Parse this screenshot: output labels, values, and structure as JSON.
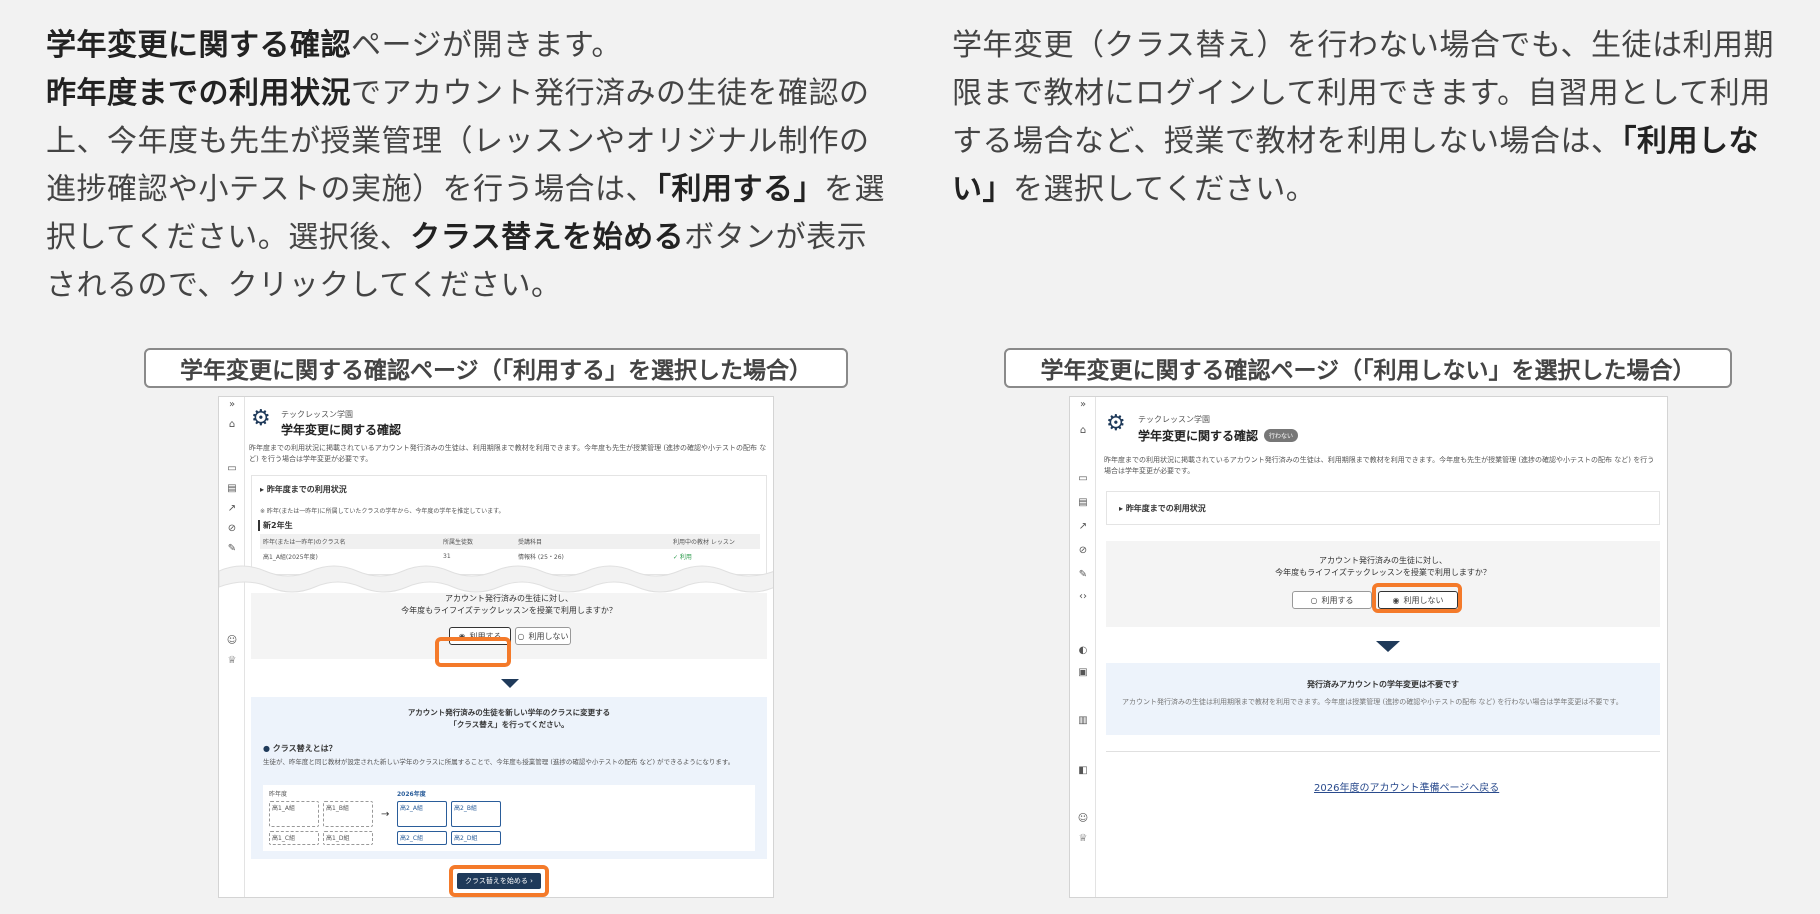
{
  "left_text": {
    "s1_bold": "学年変更に関する確認",
    "s1": "ページが開きます。",
    "s2_bold": "昨年度までの利用状況",
    "s2": "でアカウント発行済みの生徒を確認の上、今年度も先生が授業管理（レッスンやオリジナル制作の進捗確認や小テストの実施）を行う場合は、",
    "s3_bold": "「利用する」",
    "s3": "を選択してください。選択後、",
    "s4_bold": "クラス替えを始める",
    "s4": "ボタンが表示されるので、クリックしてください。"
  },
  "right_text": {
    "s1": "学年変更（クラス替え）を行わない場合でも、生徒は利用期限まで教材にログインして利用できます。自習用として利用する場合など、授業で教材を利用しない場合は、",
    "s2_bold": "「利用しない」",
    "s2": "を選択してください。"
  },
  "captions": {
    "left": "学年変更に関する確認ページ（「利用する」を選択した場合）",
    "right": "学年変更に関する確認ページ（「利用しない」を選択した場合）"
  },
  "screen": {
    "school": "テックレッスン学園",
    "title": "学年変更に関する確認",
    "status_badge": "行わない",
    "description": "昨年度までの利用状況に掲載されているアカウント発行済みの生徒は、利用期限まで教材を利用できます。今年度も先生が授業管理 (進捗の確認や小テストの配布 など) を行う場合は学年変更が必要です。",
    "usage_heading": "昨年度までの利用状況",
    "usage_note": "※ 昨年(または一昨年)に所属していたクラスの学年から、今年度の学年を推定しています。",
    "grade": "新2年生",
    "table_headers": [
      "昨年(または一昨年)のクラス名",
      "所属生徒数",
      "受講科目",
      "利用中の教材 レッスン"
    ],
    "table_row": [
      "高1_A組(2025年度)",
      "31",
      "情報科 (25・26)",
      "✓ 利用"
    ],
    "question_line1": "アカウント発行済みの生徒に対し、",
    "question_line2": "今年度もライフイズテックレッスンを授業で利用しますか？",
    "option_use": "利用する",
    "option_not_use": "利用しない",
    "change_msg_line1": "アカウント発行済みの生徒を新しい学年のクラスに変更する",
    "change_msg_line2": "「クラス替え」を行ってください。",
    "what_is": "クラス替えとは？",
    "what_is_desc": "生徒が、昨年度と同じ教材が設定された新しい学年のクラスに所属することで、今年度も授業管理 (進捗の確認や小テストの配布 など) ができるようになります。",
    "diagram": {
      "prev_year": "昨年度",
      "next_year": "2026年度",
      "prev_classes": [
        "高1_A組",
        "高1_B組",
        "高1_C組",
        "高1_D組"
      ],
      "next_classes": [
        "高2_A組",
        "高2_B組",
        "高2_C組",
        "高2_D組"
      ],
      "material": "教材"
    },
    "start_button": "クラス替えを始める",
    "not_needed_title": "発行済みアカウントの学年変更は不要です",
    "not_needed_desc": "アカウント発行済みの生徒は利用期限まで教材を利用できます。今年度は授業管理 (進捗の確認や小テストの配布 など) を行わない場合は学年変更は不要です。",
    "back_link": "2026年度のアカウント準備ページへ戻る"
  },
  "colors": {
    "highlight": "#f47a2a",
    "navy": "#1f3a5a",
    "info_bg": "#edf3fb"
  }
}
